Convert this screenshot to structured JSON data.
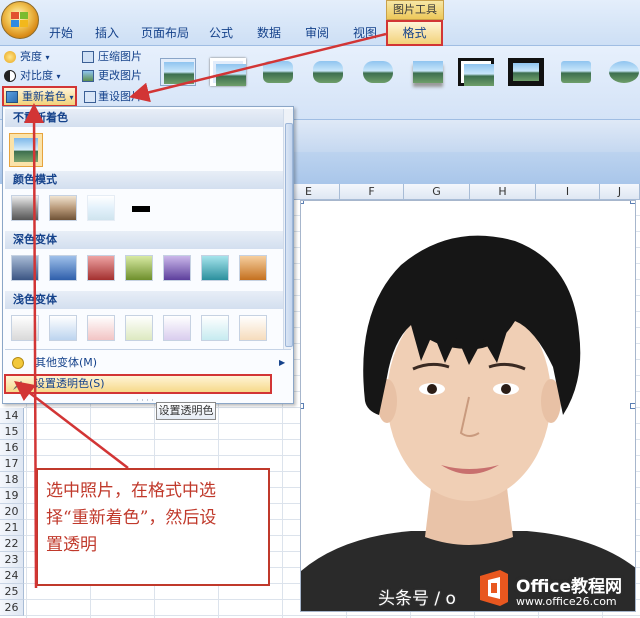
{
  "ribbon": {
    "context_label": "图片工具",
    "tabs": [
      {
        "label": "开始"
      },
      {
        "label": "插入"
      },
      {
        "label": "页面布局"
      },
      {
        "label": "公式"
      },
      {
        "label": "数据"
      },
      {
        "label": "审阅"
      },
      {
        "label": "视图"
      }
    ],
    "active_tab": {
      "label": "格式"
    },
    "adjust": {
      "brightness": "亮度",
      "contrast": "对比度",
      "recolor": "重新着色",
      "compress": "压缩图片",
      "change": "更改图片",
      "reset": "重设图片"
    }
  },
  "columns": [
    "E",
    "F",
    "G",
    "H",
    "I",
    "J"
  ],
  "rows": [
    "14",
    "15",
    "16",
    "17",
    "18",
    "19",
    "20",
    "21",
    "22",
    "23",
    "24",
    "25",
    "26"
  ],
  "recolor_menu": {
    "sections": [
      {
        "title": "不重新着色"
      },
      {
        "title": "颜色模式"
      },
      {
        "title": "深色变体"
      },
      {
        "title": "浅色变体"
      }
    ],
    "more_variations": "其他变体(M)",
    "set_transparent": "设置透明色(S)",
    "tooltip": "设置透明色"
  },
  "annotation": {
    "lines": [
      "选中照片，在格式中选",
      "择“重新着色”，然后设",
      "置透明"
    ]
  },
  "watermark": {
    "text": "头条号 / o",
    "brand": "Office教程网",
    "url": "www.office26.com"
  },
  "colors": {
    "accent_red": "#d23535",
    "ribbon_blue": "#15428b",
    "highlight_gold": "#f2d27a"
  }
}
